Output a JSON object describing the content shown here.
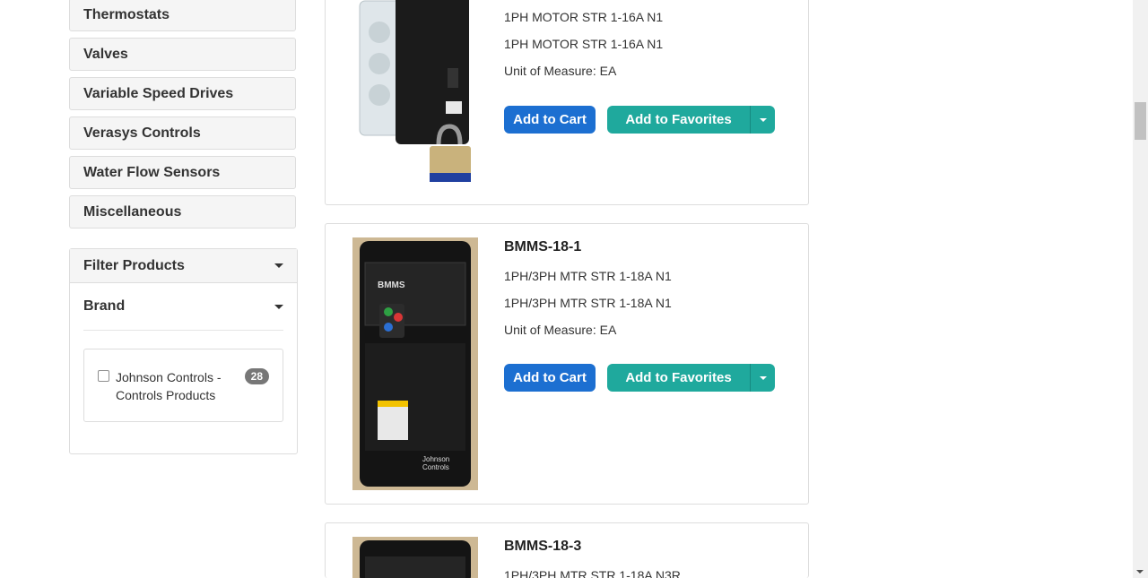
{
  "categories": [
    "Thermostats",
    "Valves",
    "Variable Speed Drives",
    "Verasys Controls",
    "Water Flow Sensors",
    "Miscellaneous"
  ],
  "filter": {
    "title": "Filter Products",
    "brand_title": "Brand",
    "brand_option": {
      "label": "Johnson Controls - Controls Products",
      "count": "28"
    }
  },
  "products": [
    {
      "name": "",
      "line1": "1PH MOTOR STR 1-16A N1",
      "line2": "1PH MOTOR STR 1-16A N1",
      "uom": "Unit of Measure: EA",
      "cart_label": "Add to Cart",
      "fav_label": "Add to Favorites"
    },
    {
      "name": "BMMS-18-1",
      "line1": "1PH/3PH MTR STR 1-18A N1",
      "line2": "1PH/3PH MTR STR 1-18A N1",
      "uom": "Unit of Measure: EA",
      "cart_label": "Add to Cart",
      "fav_label": "Add to Favorites"
    },
    {
      "name": "BMMS-18-3",
      "line1": "1PH/3PH MTR STR 1-18A N3R"
    }
  ],
  "image_text": {
    "panel_logo": "BMMS",
    "brand_logo_line1": "Johnson",
    "brand_logo_line2": "Controls"
  },
  "colors": {
    "cart": "#1c6fd1",
    "favorites": "#1fa99d",
    "badge": "#777777"
  }
}
